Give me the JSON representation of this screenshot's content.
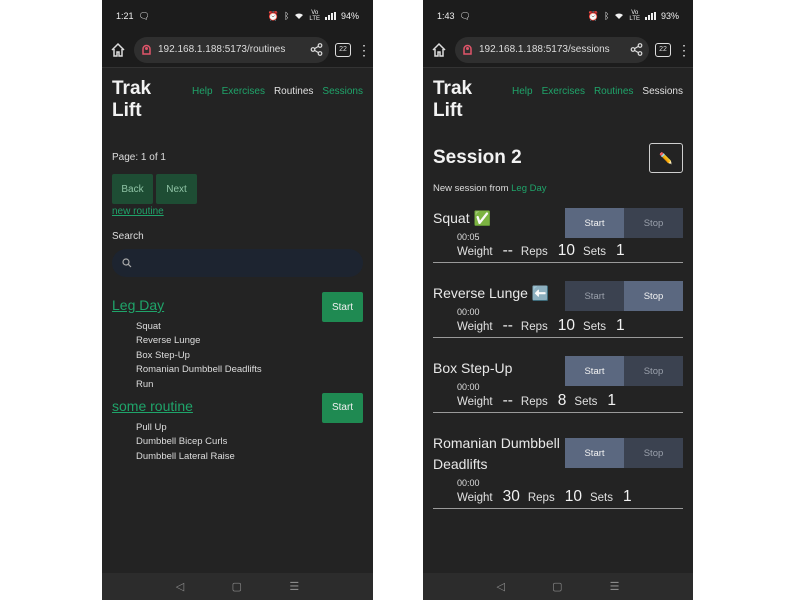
{
  "left": {
    "status": {
      "time": "1:21",
      "volte_top": "Vo",
      "volte_bottom": "LTE",
      "battery": "94%"
    },
    "browser": {
      "url": "192.168.1.188:5173/routines",
      "tab_count": "22"
    },
    "app": {
      "title": "Trak Lift"
    },
    "nav": [
      {
        "label": "Help"
      },
      {
        "label": "Exercises"
      },
      {
        "label": "Routines"
      },
      {
        "label": "Sessions"
      }
    ],
    "page_label": "Page: 1 of 1",
    "back_label": "Back",
    "next_label": "Next",
    "new_routine_label": "new routine",
    "search_label": "Search",
    "search_placeholder": "",
    "start_label": "Start",
    "routines": [
      {
        "name": "Leg Day",
        "exercises": [
          "Squat",
          "Reverse Lunge",
          "Box Step-Up",
          "Romanian Dumbbell Deadlifts",
          "Run"
        ]
      },
      {
        "name": "some routine",
        "exercises": [
          "Pull Up",
          "Dumbbell Bicep Curls",
          "Dumbbell Lateral Raise"
        ]
      }
    ]
  },
  "right": {
    "status": {
      "time": "1:43",
      "volte_top": "Vo",
      "volte_bottom": "LTE",
      "battery": "93%"
    },
    "browser": {
      "url": "192.168.1.188:5173/sessions",
      "tab_count": "22"
    },
    "app": {
      "title": "Trak Lift"
    },
    "nav": [
      {
        "label": "Help"
      },
      {
        "label": "Exercises"
      },
      {
        "label": "Routines"
      },
      {
        "label": "Sessions"
      }
    ],
    "session_title": "Session 2",
    "edit_icon": "✏️",
    "subtitle_prefix": "New session from ",
    "subtitle_link": "Leg Day",
    "start_label": "Start",
    "stop_label": "Stop",
    "weight_label": "Weight",
    "reps_label": "Reps",
    "sets_label": "Sets",
    "exercises": [
      {
        "name": "Squat ✅",
        "timer": "00:05",
        "weight": "--",
        "reps": "10",
        "sets": "1"
      },
      {
        "name": "Reverse Lunge ⬅️",
        "timer": "00:00",
        "weight": "--",
        "reps": "10",
        "sets": "1"
      },
      {
        "name": "Box Step-Up",
        "timer": "00:00",
        "weight": "--",
        "reps": "8",
        "sets": "1"
      },
      {
        "name": "Romanian Dumbbell Deadlifts",
        "timer": "00:00",
        "weight": "30",
        "reps": "10",
        "sets": "1"
      }
    ]
  },
  "colors": {
    "accent": "#1fa46a",
    "background": "#232323",
    "start_button": "#1f8a52",
    "toggle_active": "#5b6880",
    "toggle_inactive": "#3b4250"
  },
  "icons": [
    "home-icon",
    "site-info-icon",
    "share-icon",
    "tabs-icon",
    "more-vert-icon",
    "search-icon",
    "edit-pencil-icon",
    "alarm-icon",
    "bluetooth-icon",
    "wifi-icon",
    "signal-icon",
    "chat-icon",
    "back-nav-icon",
    "home-nav-icon",
    "recents-nav-icon"
  ]
}
